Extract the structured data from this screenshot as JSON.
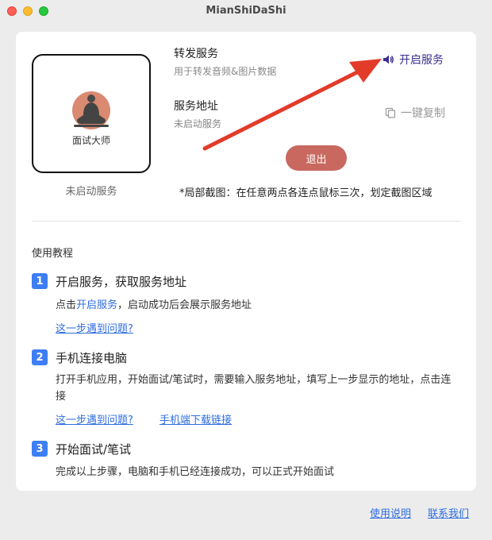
{
  "window": {
    "title": "MianShiDaShi"
  },
  "logo": {
    "caption": "面试大师",
    "status": "未启动服务"
  },
  "service": {
    "title": "转发服务",
    "description": "用于转发音频&图片数据",
    "start_label": "开启服务",
    "start_icon": "speaker-icon"
  },
  "address": {
    "title": "服务地址",
    "value": "未启动服务",
    "copy_label": "一键复制",
    "copy_icon": "copy-icon"
  },
  "exit_label": "退出",
  "tip": "*局部截图：在任意两点各连点鼠标三次，划定截图区域",
  "tutorial": {
    "heading": "使用教程",
    "steps": [
      {
        "num": "1",
        "title": "开启服务，获取服务地址",
        "body_prefix": "点击",
        "body_link": "开启服务",
        "body_suffix": "，启动成功后会展示服务地址",
        "links": [
          "这一步遇到问题?"
        ]
      },
      {
        "num": "2",
        "title": "手机连接电脑",
        "body": "打开手机应用，开始面试/笔试时，需要输入服务地址，填写上一步显示的地址，点击连接",
        "links": [
          "这一步遇到问题?",
          "手机端下载链接"
        ]
      },
      {
        "num": "3",
        "title": "开始面试/笔试",
        "body": "完成以上步骤，电脑和手机已经连接成功，可以正式开始面试",
        "links": []
      }
    ]
  },
  "footer": {
    "help_label": "使用说明",
    "contact_label": "联系我们"
  },
  "colors": {
    "accent": "#3d7ef5",
    "exit": "#c8685f",
    "arrow": "#e23b2a",
    "link": "#2f6de0"
  }
}
